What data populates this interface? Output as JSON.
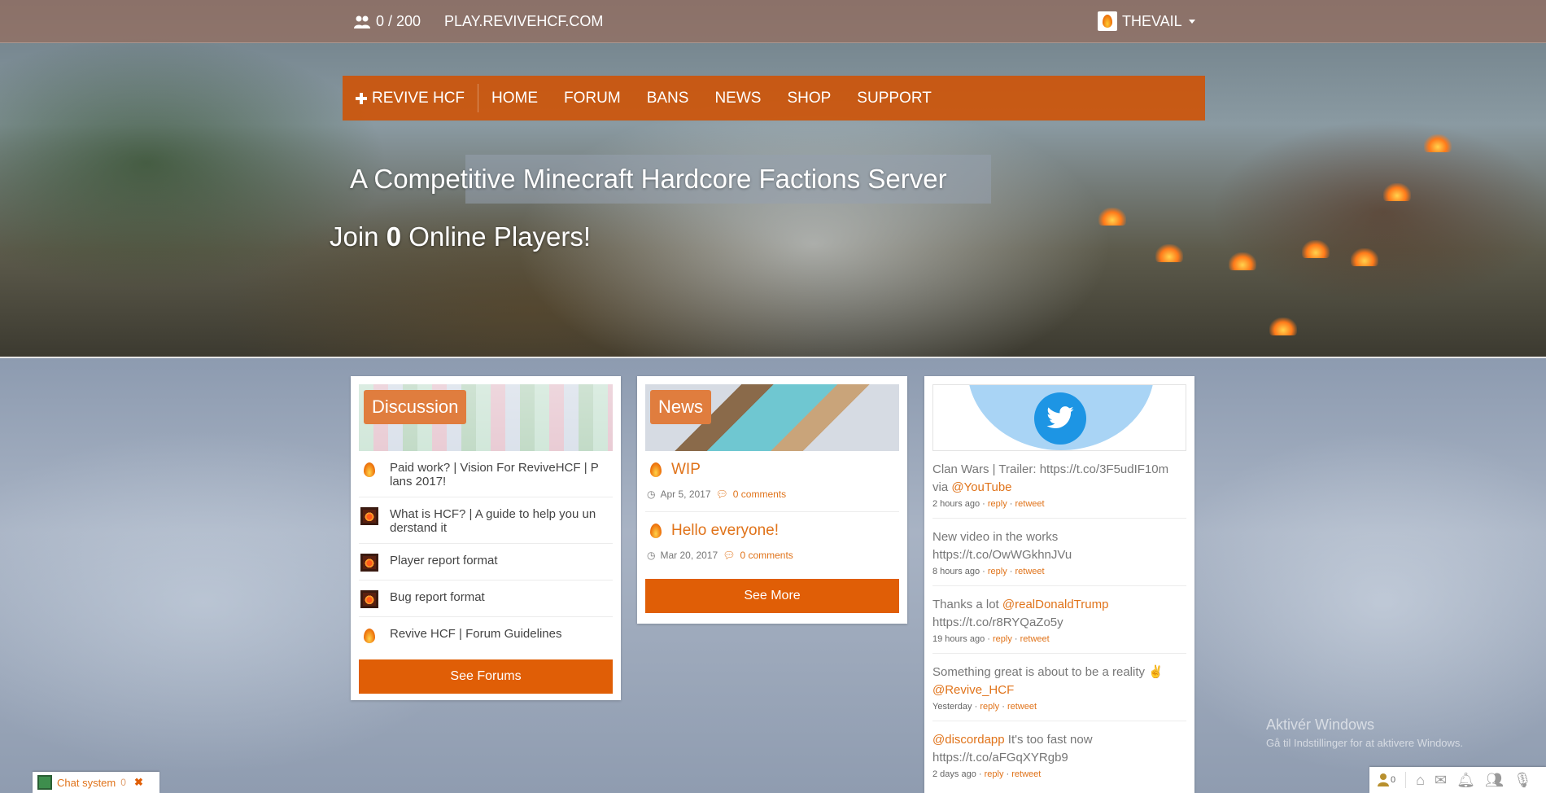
{
  "topbar": {
    "players": "0 / 200",
    "server_ip": "PLAY.REVIVEHCF.COM",
    "username": "THEVAIL"
  },
  "nav": {
    "brand": "REVIVE HCF",
    "items": [
      "HOME",
      "FORUM",
      "BANS",
      "NEWS",
      "SHOP",
      "SUPPORT"
    ]
  },
  "hero": {
    "tagline": "A Competitive Minecraft Hardcore Factions Server",
    "join_prefix": "Join ",
    "join_count": "0",
    "join_suffix": " Online Players!"
  },
  "discussion": {
    "label": "Discussion",
    "items": [
      {
        "title": "Paid work? | Vision For ReviveHCF | P lans 2017!",
        "icon": "flame-icon"
      },
      {
        "title": "What is HCF? | A guide to help you un derstand it",
        "icon": "creeper-icon"
      },
      {
        "title": "Player report format",
        "icon": "creeper-icon"
      },
      {
        "title": "Bug report format",
        "icon": "creeper-icon"
      },
      {
        "title": "Revive HCF | Forum Guidelines",
        "icon": "flame-icon"
      }
    ],
    "button": "See Forums"
  },
  "news": {
    "label": "News",
    "items": [
      {
        "title": "WIP",
        "date": "Apr 5, 2017",
        "comments": "0 comments"
      },
      {
        "title": "Hello everyone!",
        "date": "Mar 20, 2017",
        "comments": "0 comments"
      }
    ],
    "button": "See More"
  },
  "twitter": {
    "tweets": [
      {
        "pre": "Clan Wars | Trailer: https://t.co/3F5udIF10m via ",
        "handle": "@YouTube",
        "post": "",
        "time": "2 hours ago"
      },
      {
        "pre": "New video in the works https://t.co/OwWGkhnJVu",
        "handle": "",
        "post": "",
        "time": "8 hours ago"
      },
      {
        "pre": "Thanks a lot ",
        "handle": "@realDonaldTrump",
        "post": " https://t.co/r8RYQaZo5y",
        "time": "19 hours ago"
      },
      {
        "pre": "Something great is about to be a reality ✌ ",
        "handle": "@Revive_HCF",
        "post": "",
        "time": "Yesterday"
      },
      {
        "pre": "",
        "handle": "@discordapp",
        "post": " It's too fast now https://t.co/aFGqXYRgb9",
        "time": "2 days ago"
      }
    ],
    "reply": "reply",
    "retweet": "retweet"
  },
  "chat": {
    "label": "Chat system",
    "count": "0"
  },
  "toolbar": {
    "user_count": "0"
  },
  "watermark": {
    "line1": "Aktivér Windows",
    "line2": "Gå til Indstillinger for at aktivere Windows."
  }
}
